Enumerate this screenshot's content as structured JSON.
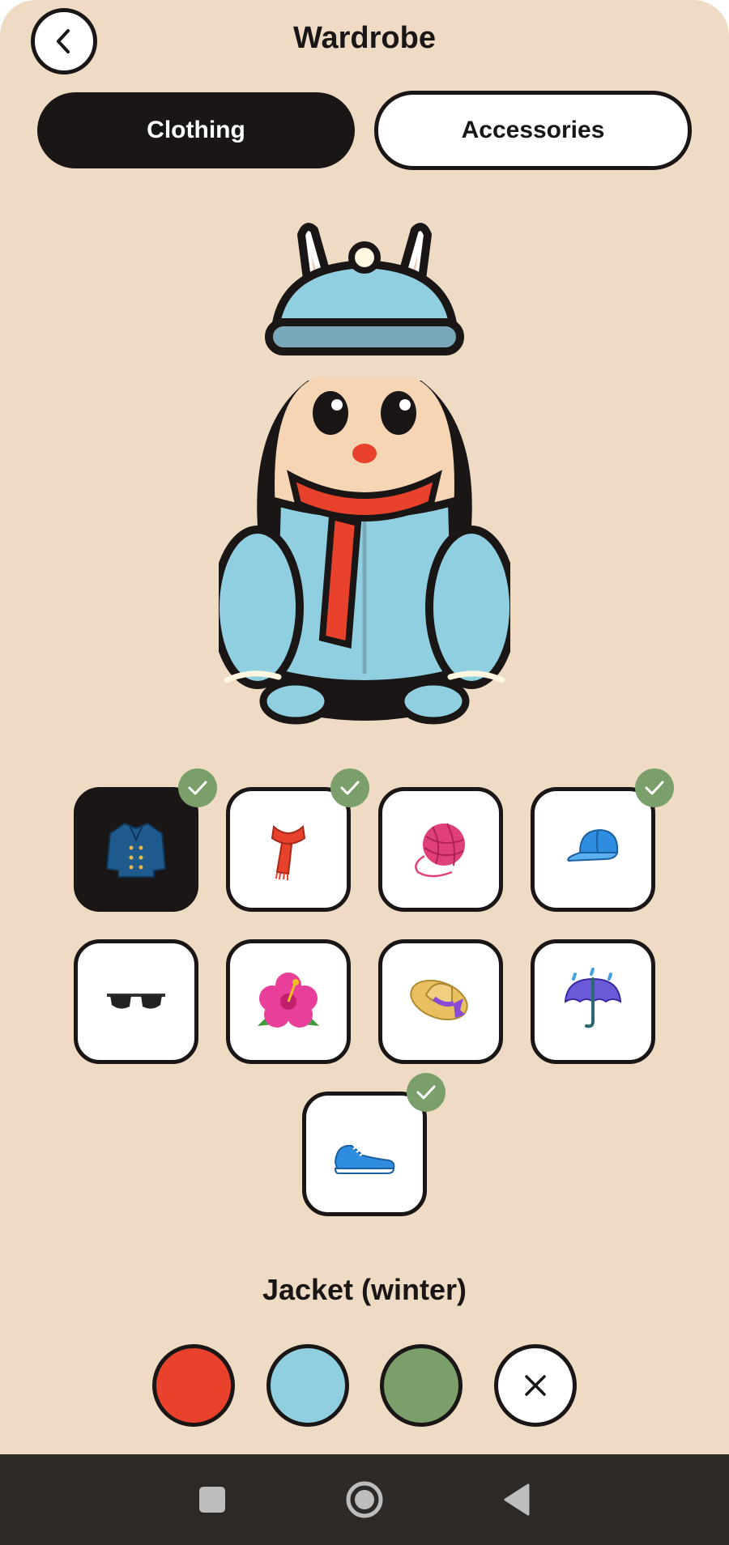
{
  "header": {
    "title": "Wardrobe",
    "back_icon": "chevron-left-icon"
  },
  "tabs": [
    {
      "label": "Clothing",
      "active": true
    },
    {
      "label": "Accessories",
      "active": false
    }
  ],
  "items": [
    {
      "icon": "coat-icon",
      "selected": true,
      "equipped": true
    },
    {
      "icon": "scarf-icon",
      "selected": false,
      "equipped": true
    },
    {
      "icon": "yarn-ball-icon",
      "selected": false,
      "equipped": false
    },
    {
      "icon": "cap-icon",
      "selected": false,
      "equipped": true
    },
    {
      "icon": "sunglasses-icon",
      "selected": false,
      "equipped": false
    },
    {
      "icon": "hibiscus-icon",
      "selected": false,
      "equipped": false
    },
    {
      "icon": "sun-hat-icon",
      "selected": false,
      "equipped": false
    },
    {
      "icon": "umbrella-icon",
      "selected": false,
      "equipped": false
    },
    {
      "icon": "sneaker-icon",
      "selected": false,
      "equipped": true
    }
  ],
  "selected_item": {
    "name": "Jacket (winter)"
  },
  "swatches": [
    {
      "name": "red",
      "color": "#e8412c"
    },
    {
      "name": "light-blue",
      "color": "#8fcfe0"
    },
    {
      "name": "green",
      "color": "#7a9f6a"
    },
    {
      "name": "none",
      "color": "#ffffff"
    }
  ],
  "colors": {
    "background": "#efdbc3",
    "ink": "#1a1616",
    "accent_check": "#7a9f6a",
    "navbar": "#2d2926"
  },
  "navbar": {
    "icons": [
      "square-icon",
      "circle-home-icon",
      "triangle-back-icon"
    ]
  }
}
